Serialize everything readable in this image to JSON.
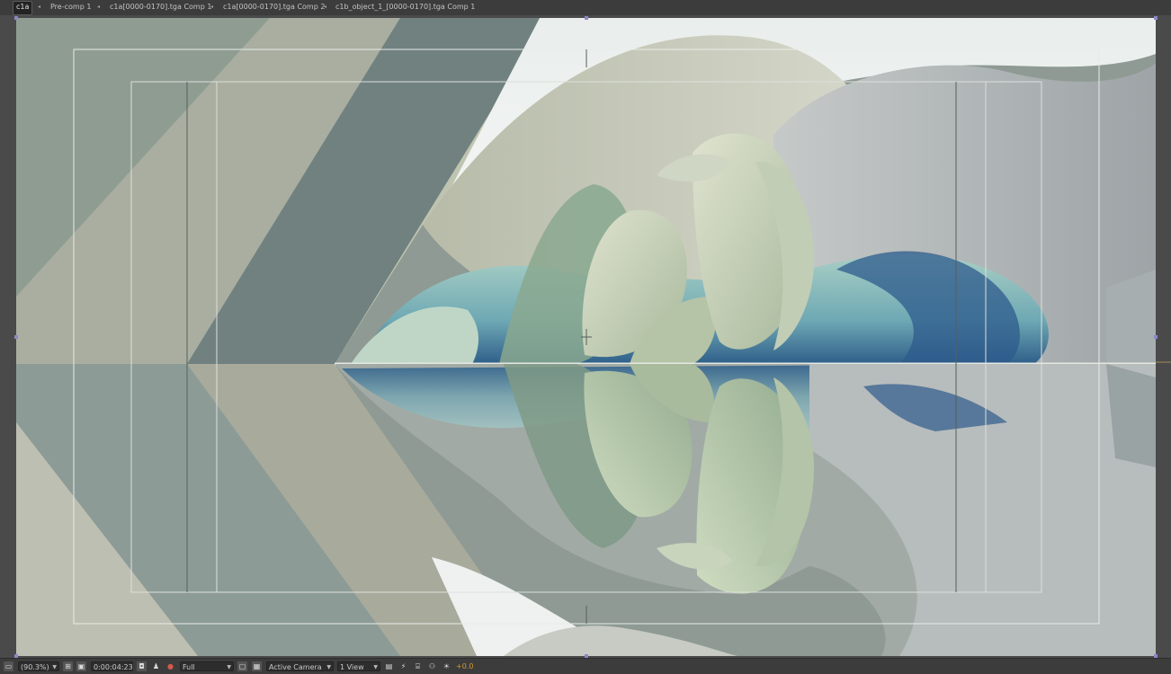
{
  "breadcrumb": {
    "items": [
      {
        "label": "c1a",
        "active": true
      },
      {
        "label": "Pre-comp 1"
      },
      {
        "label": "c1a[0000-0170].tga Comp 1"
      },
      {
        "label": "c1a[0000-0170].tga Comp 2"
      },
      {
        "label": "c1b_object_1_[0000-0170].tga Comp 1"
      }
    ],
    "separator": "◂"
  },
  "viewer": {
    "background": "#4a4a4a",
    "frame_background": "#8a968f"
  },
  "toolbar": {
    "magnification": "(90.3%)",
    "timecode": "0:00:04:23",
    "resolution": "Full",
    "camera": "Active Camera",
    "views": "1 View",
    "exposure": "+0.0",
    "icons": {
      "always_preview": "always-preview-icon",
      "safe_margins": "safe-margins-icon",
      "mask_visibility": "mask-visibility-icon",
      "snapshot": "camera-snapshot-icon",
      "show_snapshot": "show-snapshot-icon",
      "channel": "color-channels-icon",
      "region_of_interest": "region-of-interest-icon",
      "transparency_grid": "transparency-grid-icon",
      "toggle_pixel_aspect": "pixel-aspect-icon",
      "fast_previews": "fast-previews-icon",
      "timeline": "timeline-icon",
      "flowchart": "flowchart-icon",
      "reset_exposure": "reset-exposure-icon"
    },
    "exposure_color": "#d69a2a"
  }
}
